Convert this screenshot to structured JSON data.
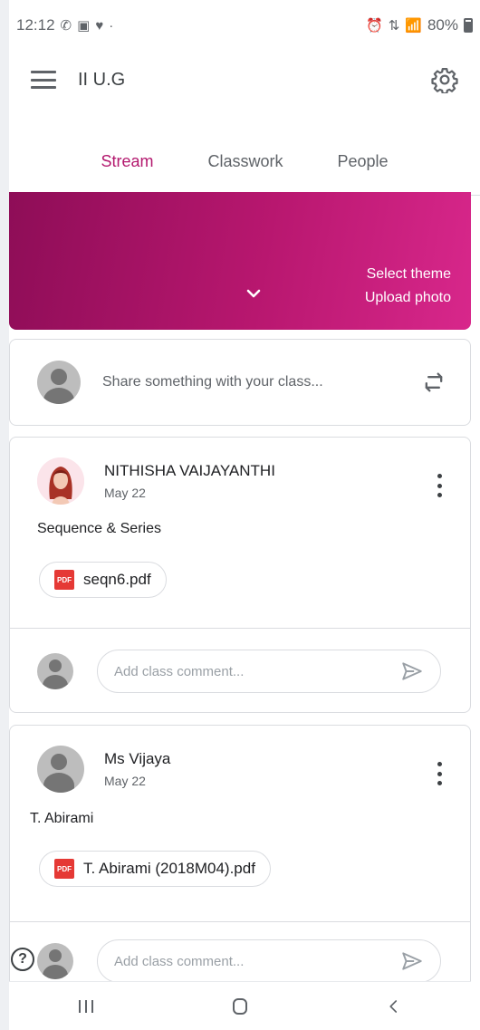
{
  "status_bar": {
    "time": "12:12",
    "battery": "80%"
  },
  "app_bar": {
    "class_name": "II U.G"
  },
  "tabs": [
    {
      "label": "Stream",
      "active": true
    },
    {
      "label": "Classwork",
      "active": false
    },
    {
      "label": "People",
      "active": false
    }
  ],
  "banner": {
    "select_theme": "Select theme",
    "upload_photo": "Upload photo",
    "color_start": "#8e0d57",
    "color_end": "#d8278b"
  },
  "share": {
    "placeholder": "Share something with your class..."
  },
  "posts": [
    {
      "author": "NITHISHA VAIJAYANTHI",
      "date": "May 22",
      "body": "Sequence & Series",
      "attachment": "seqn6.pdf",
      "comment_placeholder": "Add class comment..."
    },
    {
      "author": "Ms Vijaya",
      "date": "May 22",
      "body": "T. Abirami",
      "attachment": "T. Abirami (2018M04).pdf",
      "comment_placeholder": "Add class comment..."
    }
  ],
  "icons": {
    "pdf_label": "PDF",
    "help": "?"
  },
  "colors": {
    "accent": "#b3186e"
  }
}
